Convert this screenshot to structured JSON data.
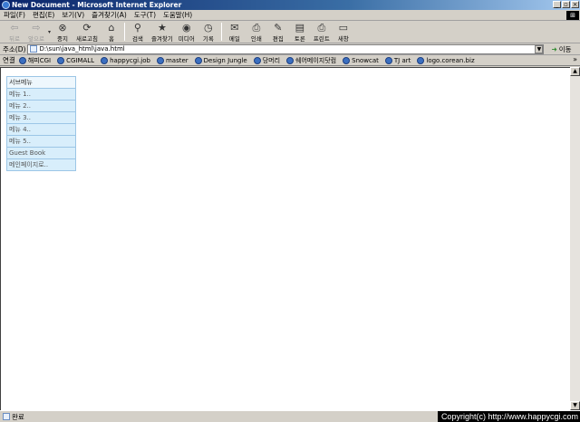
{
  "window": {
    "title": "New Document - Microsoft Internet Explorer",
    "controls": [
      "_",
      "▫",
      "×"
    ]
  },
  "menubar": {
    "items": [
      "파일(F)",
      "편집(E)",
      "보기(V)",
      "즐겨찾기(A)",
      "도구(T)",
      "도움말(H)"
    ]
  },
  "toolbar": {
    "buttons": [
      {
        "label": "뒤로",
        "icon": "back-arrow-icon",
        "glyph": "⇦"
      },
      {
        "label": "앞으로",
        "icon": "forward-arrow-icon",
        "glyph": "⇨"
      },
      {
        "label": "중지",
        "icon": "stop-icon",
        "glyph": "⊗"
      },
      {
        "label": "새로고침",
        "icon": "refresh-icon",
        "glyph": "⟳"
      },
      {
        "label": "홈",
        "icon": "home-icon",
        "glyph": "⌂"
      },
      {
        "label": "검색",
        "icon": "search-icon",
        "glyph": "⚲"
      },
      {
        "label": "즐겨찾기",
        "icon": "favorites-icon",
        "glyph": "★"
      },
      {
        "label": "미디어",
        "icon": "media-icon",
        "glyph": "◉"
      },
      {
        "label": "기록",
        "icon": "history-icon",
        "glyph": "◷"
      },
      {
        "label": "메일",
        "icon": "mail-icon",
        "glyph": "✉"
      },
      {
        "label": "인쇄",
        "icon": "print-icon",
        "glyph": "⎙"
      },
      {
        "label": "편집",
        "icon": "edit-icon",
        "glyph": "✎"
      },
      {
        "label": "토론",
        "icon": "discuss-icon",
        "glyph": "▤"
      },
      {
        "label": "프린트",
        "icon": "printer-icon",
        "glyph": "⎙"
      },
      {
        "label": "새창",
        "icon": "new-window-icon",
        "glyph": "▭"
      }
    ]
  },
  "address": {
    "label": "주소(D)",
    "value": "D:\\sun\\java_html\\java.html",
    "go_label": "이동"
  },
  "links": {
    "label": "연결",
    "items": [
      "해피CGI",
      "CGIMALL",
      "happycgi.job",
      "master",
      "Design Jungle",
      "당머리",
      "쉐어메이지닷컴",
      "Snowcat",
      "TJ art",
      "logo.corean.biz"
    ],
    "more": "»"
  },
  "submenu": {
    "title": "서브메뉴",
    "items": [
      "메뉴 1..",
      "메뉴 2..",
      "메뉴 3..",
      "메뉴 4..",
      "메뉴 5..",
      "Guest Book",
      "메인페이지로.."
    ]
  },
  "status": {
    "text": "완료",
    "copyright": "Copyright(c) http://www.happycgi.com"
  }
}
